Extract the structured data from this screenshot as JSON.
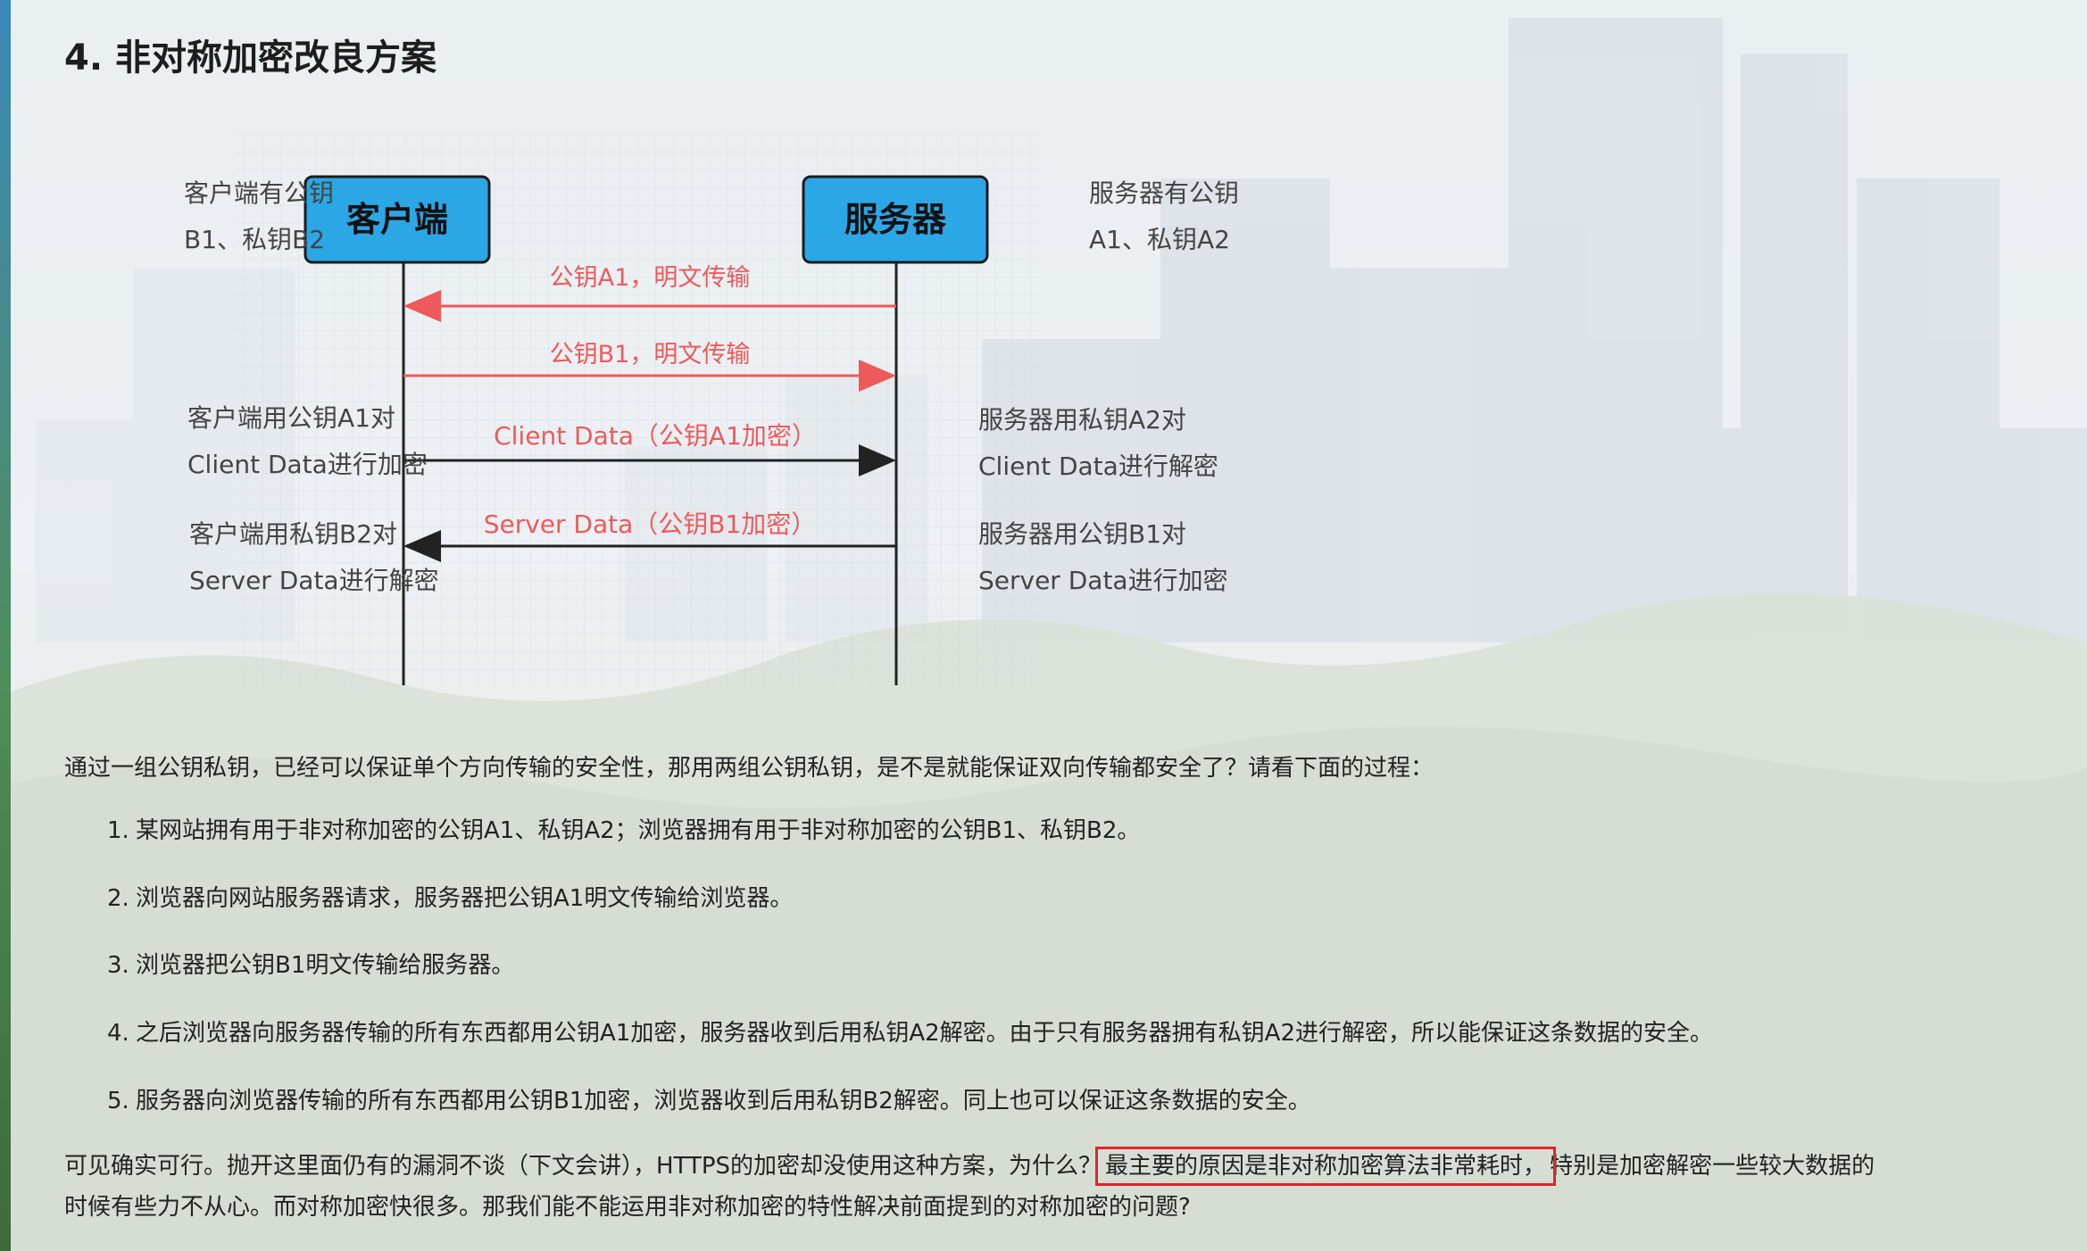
{
  "heading": "4. 非对称加密改良方案",
  "diagram": {
    "client_box": "客户端",
    "server_box": "服务器",
    "client_keys_line1": "客户端有公钥",
    "client_keys_line2": "B1、私钥B2",
    "server_keys_line1": "服务器有公钥",
    "server_keys_line2": "A1、私钥A2",
    "msg1": "公钥A1，明文传输",
    "msg2": "公钥B1，明文传输",
    "msg3": "Client Data（公钥A1加密）",
    "msg4": "Server Data（公钥B1加密）",
    "client_note1_line1": "客户端用公钥A1对",
    "client_note1_line2": "Client Data进行加密",
    "client_note2_line1": "客户端用私钥B2对",
    "client_note2_line2": "Server Data进行解密",
    "server_note1_line1": "服务器用私钥A2对",
    "server_note1_line2": "Client Data进行解密",
    "server_note2_line1": "服务器用公钥B1对",
    "server_note2_line2": "Server Data进行加密",
    "colors": {
      "box_fill": "#2ba7e6",
      "red_arrow": "#ee5a5a",
      "black_arrow": "#222222"
    }
  },
  "intro": "通过一组公钥私钥，已经可以保证单个方向传输的安全性，那用两组公钥私钥，是不是就能保证双向传输都安全了？请看下面的过程：",
  "steps": [
    {
      "num": "1.",
      "text": "某网站拥有用于非对称加密的公钥A1、私钥A2；浏览器拥有用于非对称加密的公钥B1、私钥B2。"
    },
    {
      "num": "2.",
      "text": "浏览器向网站服务器请求，服务器把公钥A1明文传输给浏览器。"
    },
    {
      "num": "3.",
      "text": "浏览器把公钥B1明文传输给服务器。"
    },
    {
      "num": "4.",
      "text": "之后浏览器向服务器传输的所有东西都用公钥A1加密，服务器收到后用私钥A2解密。由于只有服务器拥有私钥A2进行解密，所以能保证这条数据的安全。"
    },
    {
      "num": "5.",
      "text": "服务器向浏览器传输的所有东西都用公钥B1加密，浏览器收到后用私钥B2解密。同上也可以保证这条数据的安全。"
    }
  ],
  "conclusion": {
    "part1": "可见确实可行。抛开这里面仍有的漏洞不谈（下文会讲），HTTPS的加密却没使用这种方案，为什么？",
    "highlight": "最主要的原因是非对称加密算法非常耗时，",
    "part2": "特别是加密解密一些较大数据的",
    "line2": "时候有些力不从心。而对称加密快很多。那我们能不能运用非对称加密的特性解决前面提到的对称加密的问题?"
  }
}
